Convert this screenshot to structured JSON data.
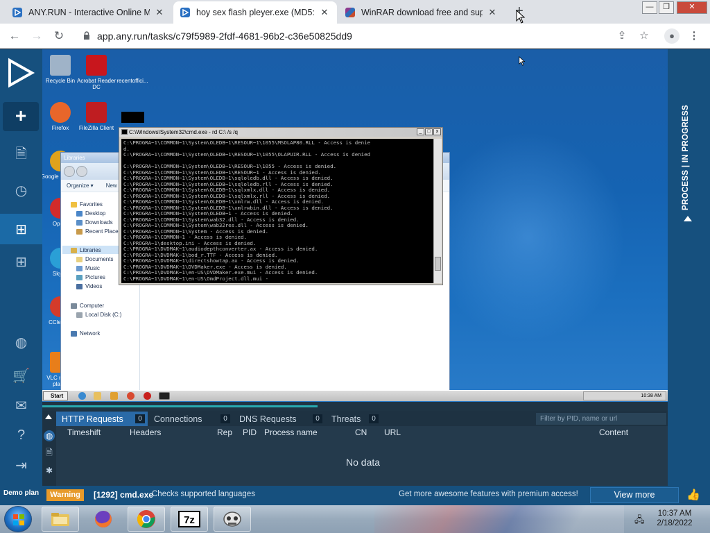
{
  "browser": {
    "tabs": [
      {
        "title": "ANY.RUN - Interactive Online Ma",
        "close": "✕"
      },
      {
        "title": "hoy sex flash pleyer.exe (MD5: 0",
        "close": "✕"
      },
      {
        "title": "WinRAR download free and supp",
        "close": "✕"
      }
    ],
    "new_tab": "+",
    "window_controls": {
      "minimize": "—",
      "restore": "❐",
      "close": "✕"
    },
    "url": "app.any.run/tasks/c79f5989-2fdf-4681-96b2-c36e50825dd9"
  },
  "desktop_icons": [
    {
      "label": "Recycle Bin",
      "color": "#9fb3c8"
    },
    {
      "label": "Acrobat Reader DC",
      "color": "#c8161d"
    },
    {
      "label": "recentoffici...",
      "color": "#1a5ea8"
    },
    {
      "label": "Firefox",
      "color": "#e8662a"
    },
    {
      "label": "FileZilla Client",
      "color": "#bf1d21"
    },
    {
      "label": "Google Chrome",
      "color": "#e0a21c"
    },
    {
      "label": "Opera",
      "color": "#d22b2b"
    },
    {
      "label": "Skype",
      "color": "#2a9fd6"
    },
    {
      "label": "CCleaner",
      "color": "#d43b2a"
    },
    {
      "label": "VLC media player",
      "color": "#e87e1a"
    }
  ],
  "explorer": {
    "title": "Libraries",
    "organize": "Organize ▾",
    "new": "New",
    "tree": [
      "Favorites",
      "Desktop",
      "Downloads",
      "Recent Places",
      "Libraries",
      "Documents",
      "Music",
      "Pictures",
      "Videos",
      "Computer",
      "Local Disk (C:)",
      "Network"
    ]
  },
  "cmd": {
    "title": "C:\\Windows\\System32\\cmd.exe - rd  C:\\ /s /q",
    "lines": [
      "C:\\PROGRA~1\\COMMON~1\\System\\OLEDB~1\\RESOUR~1\\1055\\MSOLAP80.RLL - Access is denie",
      "d.",
      "C:\\PROGRA~1\\COMMON~1\\System\\OLEDB~1\\RESOUR~1\\1055\\OLAPUIR.RLL - Access is denied",
      "",
      "C:\\PROGRA~1\\COMMON~1\\System\\OLEDB~1\\RESOUR~1\\1055 - Access is denied.",
      "C:\\PROGRA~1\\COMMON~1\\System\\OLEDB~1\\RESOUR~1 - Access is denied.",
      "C:\\PROGRA~1\\COMMON~1\\System\\OLEDB~1\\sqloledb.dll - Access is denied.",
      "C:\\PROGRA~1\\COMMON~1\\System\\OLEDB~1\\sqloledb.rll - Access is denied.",
      "C:\\PROGRA~1\\COMMON~1\\System\\OLEDB~1\\sqlxmlx.dll - Access is denied.",
      "C:\\PROGRA~1\\COMMON~1\\System\\OLEDB~1\\sqlxmlx.rll - Access is denied.",
      "C:\\PROGRA~1\\COMMON~1\\System\\OLEDB~1\\xmlrw.dll - Access is denied.",
      "C:\\PROGRA~1\\COMMON~1\\System\\OLEDB~1\\xmlrwbin.dll - Access is denied.",
      "C:\\PROGRA~1\\COMMON~1\\System\\OLEDB~1 - Access is denied.",
      "C:\\PROGRA~1\\COMMON~1\\System\\wab32.dll - Access is denied.",
      "C:\\PROGRA~1\\COMMON~1\\System\\wab32res.dll - Access is denied.",
      "C:\\PROGRA~1\\COMMON~1\\System - Access is denied.",
      "C:\\PROGRA~1\\COMMON~1 - Access is denied.",
      "C:\\PROGRA~1\\desktop.ini - Access is denied.",
      "C:\\PROGRA~1\\DVDMAK~1\\audiodepthconverter.ax - Access is denied.",
      "C:\\PROGRA~1\\DVDMAK~1\\bod_r.TTF - Access is denied.",
      "C:\\PROGRA~1\\DVDMAK~1\\directshowtap.ax - Access is denied.",
      "C:\\PROGRA~1\\DVDMAK~1\\DVDMaker.exe - Access is denied.",
      "C:\\PROGRA~1\\DVDMAK~1\\en-US\\DVDMaker.exe.mui - Access is denied.",
      "C:\\PROGRA~1\\DVDMAK~1\\en-US\\OmdProject.dll.mui -"
    ]
  },
  "vm_taskbar": {
    "start": "Start",
    "clock": "10:38 AM"
  },
  "process_strip": {
    "label": "PROCESS | IN PROGRESS"
  },
  "panel": {
    "tabs": [
      {
        "label": "HTTP Requests",
        "count": "0"
      },
      {
        "label": "Connections",
        "count": "0"
      },
      {
        "label": "DNS Requests",
        "count": "0"
      },
      {
        "label": "Threats",
        "count": "0"
      }
    ],
    "filter_placeholder": "Filter by PID, name or url",
    "columns": [
      "Timeshift",
      "Headers",
      "Rep",
      "PID",
      "Process name",
      "CN",
      "URL",
      "Content"
    ],
    "empty": "No data"
  },
  "status": {
    "warning": "Warning",
    "process": "[1292] cmd.exe",
    "message": "Checks supported languages",
    "promo": "Get more awesome features with premium access!",
    "view_more": "View more",
    "demo": "Demo plan"
  },
  "progress": {
    "fraction": 0.44
  },
  "host_taskbar": {
    "time": "10:37 AM",
    "date": "2/18/2022"
  },
  "colors": {
    "accent": "#16507e",
    "warning": "#e79a2a",
    "active_tab": "#2a6aa7"
  }
}
